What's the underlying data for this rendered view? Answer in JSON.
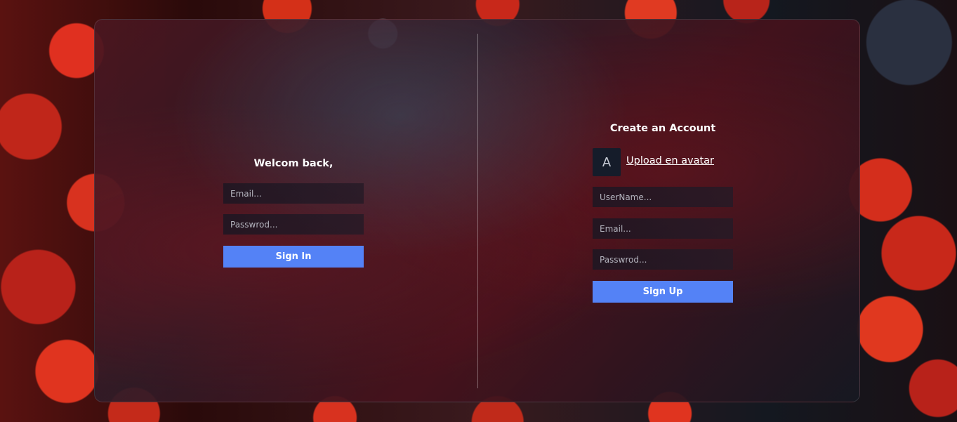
{
  "login": {
    "title": "Welcom back,",
    "email_placeholder": "Email...",
    "password_placeholder": "Passwrod...",
    "submit_label": "Sign In"
  },
  "signup": {
    "title": "Create an Account",
    "avatar_letter": "A",
    "upload_label": "Upload en avatar",
    "username_placeholder": "UserName...",
    "email_placeholder": "Email...",
    "password_placeholder": "Passwrod...",
    "submit_label": "Sign Up"
  },
  "colors": {
    "accent": "#5482f6",
    "avatar_bg": "#151c2a"
  }
}
